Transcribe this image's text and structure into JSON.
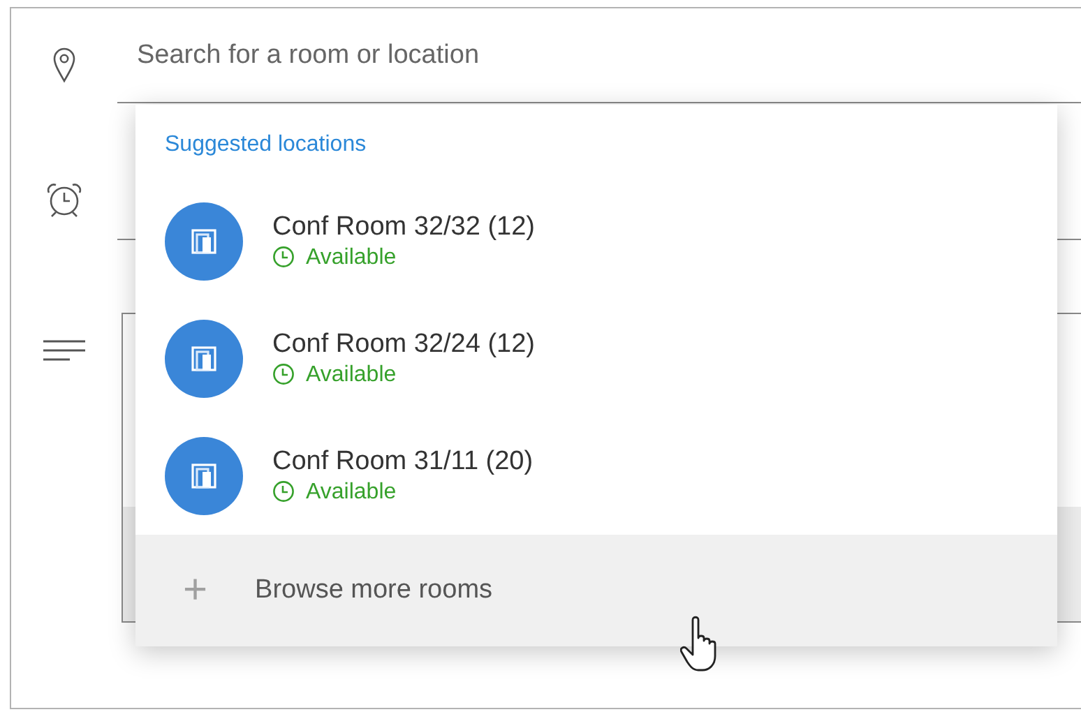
{
  "search": {
    "placeholder": "Search for a room or location"
  },
  "suggestions": {
    "header": "Suggested locations",
    "rooms": [
      {
        "name": "Conf Room 32/32 (12)",
        "status": "Available"
      },
      {
        "name": "Conf Room 32/24 (12)",
        "status": "Available"
      },
      {
        "name": "Conf Room 31/11 (20)",
        "status": "Available"
      }
    ],
    "browse": {
      "label": "Browse more rooms",
      "icon": "+"
    }
  }
}
